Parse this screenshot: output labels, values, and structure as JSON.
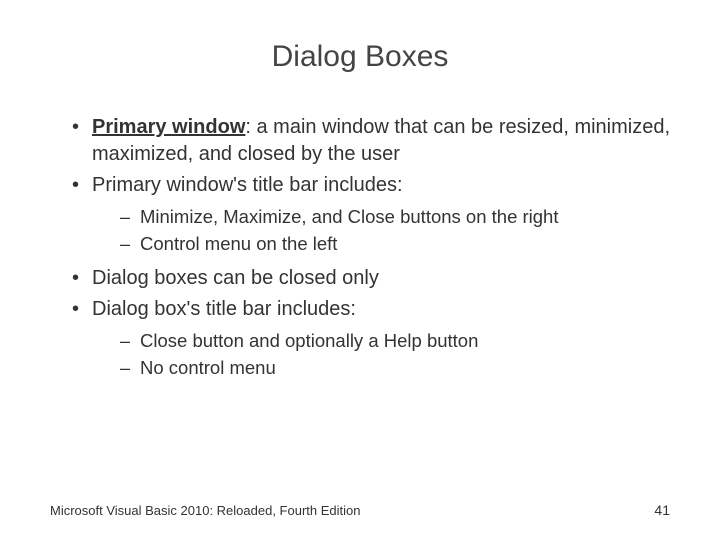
{
  "title": "Dialog Boxes",
  "bullets": {
    "item1_term": "Primary window",
    "item1_rest": ": a main window that can be resized, minimized, maximized, and closed by the user",
    "item2": "Primary window's title bar includes:",
    "item2_sub1": "Minimize, Maximize, and Close buttons on the right",
    "item2_sub2": "Control menu on the left",
    "item3": "Dialog boxes can be closed only",
    "item4": "Dialog box's title bar includes:",
    "item4_sub1": "Close button and optionally a Help button",
    "item4_sub2": "No control menu"
  },
  "footer": {
    "source": "Microsoft Visual Basic 2010: Reloaded, Fourth Edition",
    "page": "41"
  }
}
